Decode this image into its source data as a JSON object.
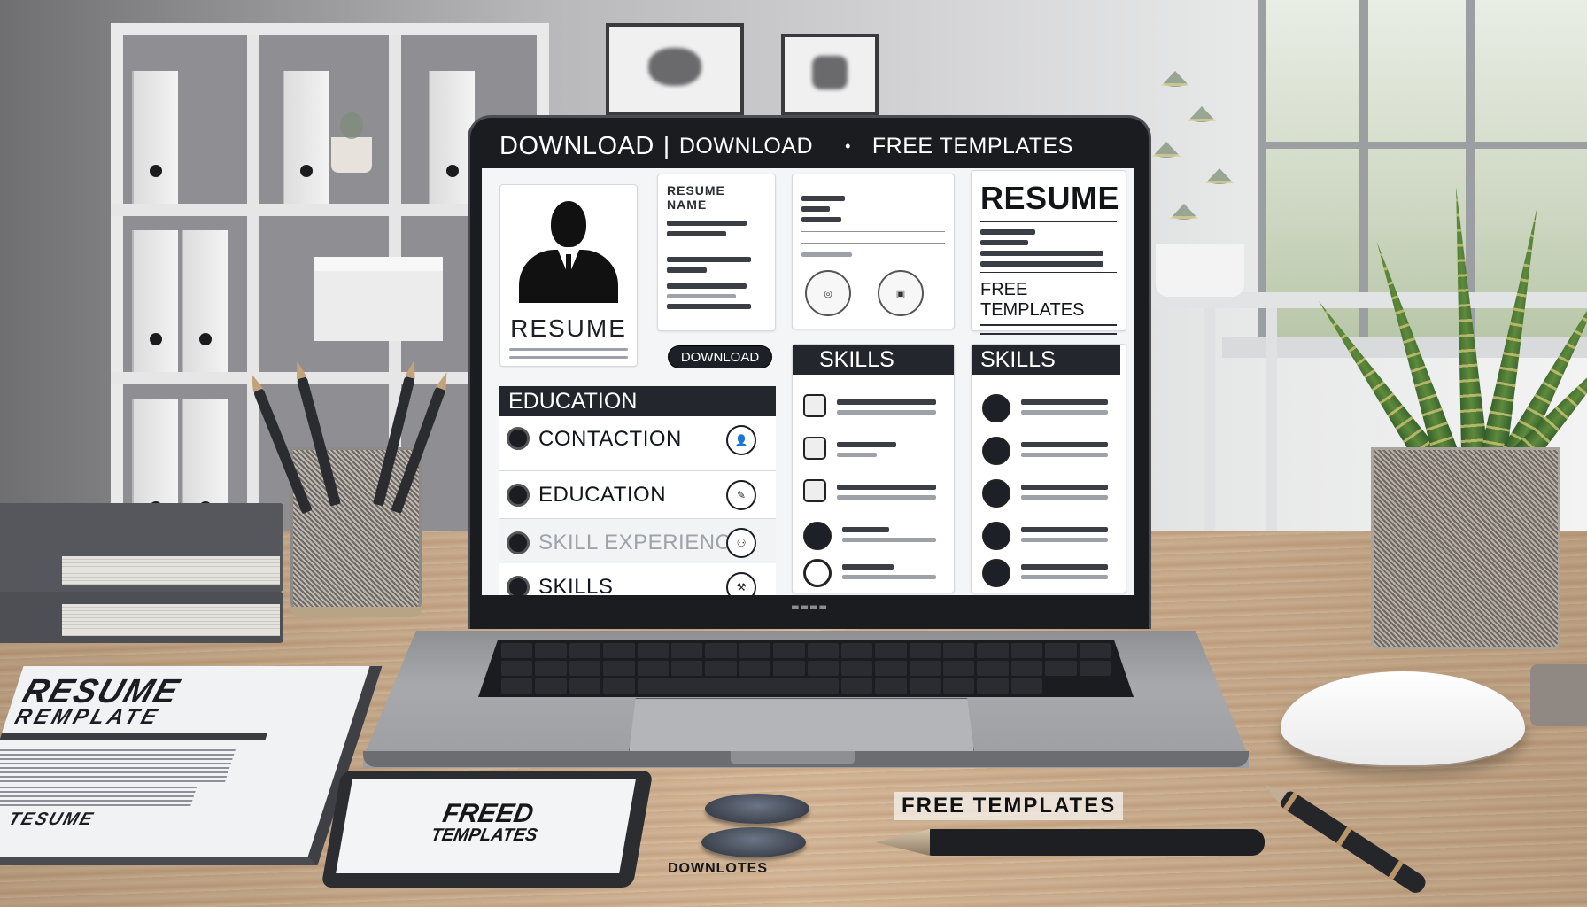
{
  "screen": {
    "header": {
      "primary": "DOWNLOAD",
      "separator": "|",
      "secondary": "DOWNLOAD",
      "bullet": "•",
      "tagline": "FREE TEMPLATES"
    },
    "profile_card": {
      "title": "RESUME",
      "icon": "person-silhouette-icon"
    },
    "info_card": {
      "title": "RESUME NAME"
    },
    "download_button": "DOWNLOAD",
    "education_panel": {
      "heading": "EDUCATION",
      "items": [
        {
          "label": "CONTACTION",
          "icon": "contact-icon",
          "action_icon": "user-icon",
          "faded": false
        },
        {
          "label": "EDUCATION",
          "icon": "education-icon",
          "action_icon": "book-icon",
          "faded": false
        },
        {
          "label": "SKILL EXPERIENCE",
          "icon": "experience-icon",
          "action_icon": "people-icon",
          "faded": true
        },
        {
          "label": "SKILLS",
          "icon": "skills-icon",
          "action_icon": "tools-icon",
          "faded": false
        }
      ]
    },
    "middle_card": {
      "badges": [
        "award-badge-icon",
        "certificate-badge-icon"
      ]
    },
    "skills_panel_1": {
      "heading": "SKILLS",
      "rows": 5,
      "icons": [
        "monitor-icon",
        "document-icon",
        "image-icon",
        "tools-icon",
        "heart-icon"
      ]
    },
    "resume_card": {
      "title": "RESUME",
      "subtitle": "FREE TEMPLATES"
    },
    "skills_panel_2": {
      "heading": "SKILLS",
      "rows": 5,
      "icons": [
        "briefcase-icon",
        "lock-icon",
        "play-icon",
        "share-icon",
        "star-icon"
      ]
    }
  },
  "desk": {
    "resume_book": {
      "title_line1": "RESUME",
      "title_line2": "REMPLATE",
      "footer": "TESUME"
    },
    "tablet": {
      "line1": "FREED",
      "line2": "TEMPLATES"
    },
    "disc_label": "DOWNLOTES",
    "desk_caption": "FREE TEMPLATES"
  },
  "colors": {
    "screen_header_bg": "#1a1c20",
    "section_bar_bg": "#23262d",
    "screen_bg": "#f4f5f7",
    "desk_wood": "#c9a987"
  }
}
